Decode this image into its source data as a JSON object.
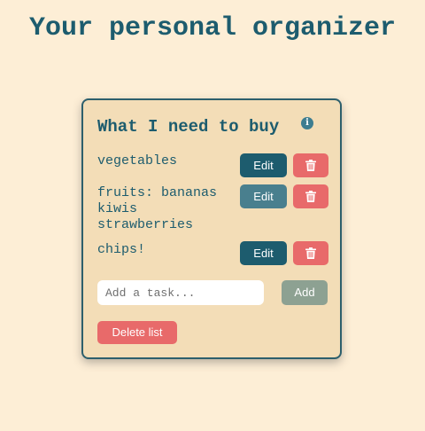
{
  "page": {
    "title": "Your personal organizer"
  },
  "list": {
    "title": "What I need to buy",
    "info_icon": "info-icon",
    "items": [
      {
        "text": "vegetables",
        "edit_label": "Edit",
        "delete_icon": "trash-icon"
      },
      {
        "text": "fruits: bananas kiwis strawberries",
        "edit_label": "Edit",
        "delete_icon": "trash-icon"
      },
      {
        "text": "chips!",
        "edit_label": "Edit",
        "delete_icon": "trash-icon"
      }
    ],
    "new_task": {
      "value": "",
      "placeholder": "Add a task..."
    },
    "add_label": "Add",
    "delete_list_label": "Delete list"
  },
  "colors": {
    "background": "#fdeed6",
    "card": "#f3ddb7",
    "primary": "#1d5c6e",
    "danger": "#e86a6a",
    "add_button": "#8da192"
  }
}
